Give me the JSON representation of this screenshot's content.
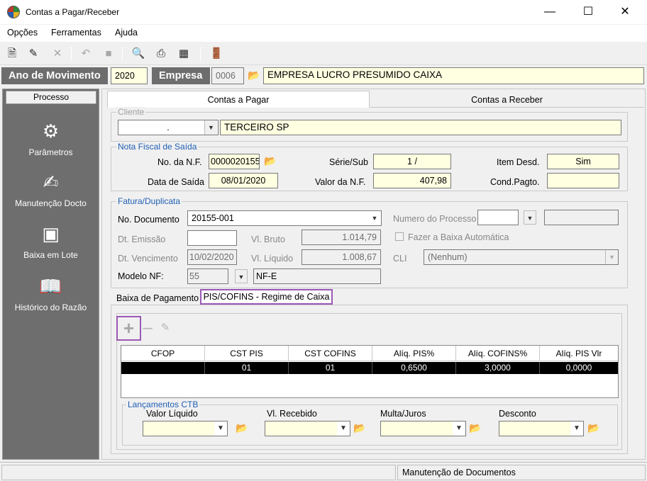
{
  "window": {
    "title": "Contas a Pagar/Receber"
  },
  "menu": [
    {
      "label": "Opções"
    },
    {
      "label": "Ferramentas"
    },
    {
      "label": "Ajuda"
    }
  ],
  "header": {
    "ano_label": "Ano de Movimento",
    "ano_value": "2020",
    "empresa_label": "Empresa",
    "empresa_code": "0006",
    "empresa_name": "EMPRESA LUCRO PRESUMIDO CAIXA"
  },
  "sidebar": {
    "title": "Processo",
    "items": [
      {
        "label": "Parâmetros",
        "icon": "gears-icon"
      },
      {
        "label": "Manutenção Docto",
        "icon": "document-edit-icon"
      },
      {
        "label": "Baixa em Lote",
        "icon": "batch-icon"
      },
      {
        "label": "Histórico do Razão",
        "icon": "book-icon"
      }
    ]
  },
  "tabs": {
    "pagar": "Contas a Pagar",
    "receber": "Contas a Receber"
  },
  "cliente": {
    "title": "Cliente",
    "code": ".",
    "name": "TERCEIRO SP"
  },
  "nota": {
    "title": "Nota Fiscal de Saída",
    "nf_label": "No. da N.F.",
    "nf_value": "0000020155",
    "serie_label": "Série/Sub",
    "serie_value": "1 /",
    "item_label": "Item Desd.",
    "item_value": "Sim",
    "data_label": "Data de Saída",
    "data_value": "08/01/2020",
    "valor_label": "Valor da N.F.",
    "valor_value": "407,98",
    "cond_label": "Cond.Pagto.",
    "cond_value": ""
  },
  "fatura": {
    "title": "Fatura/Duplicata",
    "doc_label": "No. Documento",
    "doc_value": "20155-001",
    "processo_label": "Numero do Processo",
    "emissao_label": "Dt. Emissão",
    "emissao_value": "",
    "bruto_label": "Vl. Bruto",
    "bruto_value": "1.014,79",
    "baixa_auto_label": "Fazer a Baixa Automática",
    "venc_label": "Dt. Vencimento",
    "venc_value": "10/02/2020",
    "liquido_label": "Vl. Líquido",
    "liquido_value": "1.008,67",
    "cli_label": "CLI",
    "cli_value": "(Nenhum)",
    "modelo_label": "Modelo NF:",
    "modelo_code": "55",
    "modelo_name": "NF-E"
  },
  "inner_tabs": {
    "baixa": "Baixa de Pagamento",
    "pis": "PIS/COFINS - Regime de Caixa"
  },
  "grid": {
    "columns": [
      "CFOP",
      "CST PIS",
      "CST COFINS",
      "Alíq. PIS%",
      "Alíq. COFINS%",
      "Alíq. PIS Vlr"
    ],
    "rows": [
      [
        "",
        "01",
        "01",
        "0,6500",
        "3,0000",
        "0,0000"
      ]
    ]
  },
  "lancamentos": {
    "title": "Lançamentos CTB",
    "valor_liquido": "Valor Líquido",
    "vl_recebido": "Vl. Recebido",
    "multa": "Multa/Juros",
    "desconto": "Desconto"
  },
  "status": {
    "left": "",
    "right": "Manutenção de Documentos"
  },
  "colors": {
    "accent_blue": "#1f5fb4",
    "highlight_purple": "#9b59b6",
    "yellow_field": "#ffffe1",
    "sidebar": "#6e6e6e"
  }
}
